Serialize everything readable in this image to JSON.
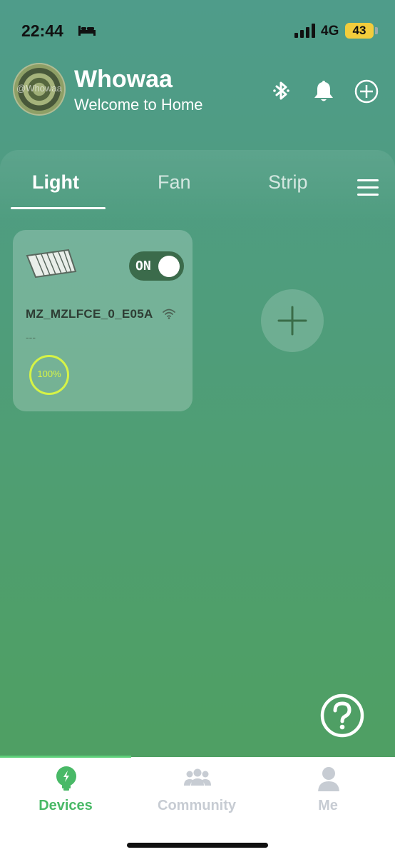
{
  "status_bar": {
    "time": "22:44",
    "network": "4G",
    "battery": "43"
  },
  "header": {
    "avatar_text": "@Whowaa",
    "title": "Whowaa",
    "subtitle": "Welcome to Home"
  },
  "tabs": [
    {
      "label": "Light",
      "active": true
    },
    {
      "label": "Fan",
      "active": false
    },
    {
      "label": "Strip",
      "active": false
    }
  ],
  "device": {
    "name": "MZ_MZLFCE_0_E05A",
    "toggle_label": "ON",
    "toggle_on": true,
    "subtitle": "---",
    "brightness": "100%"
  },
  "bottom_nav": [
    {
      "label": "Devices",
      "icon": "bulb-icon",
      "active": true
    },
    {
      "label": "Community",
      "icon": "people-icon",
      "active": false
    },
    {
      "label": "Me",
      "icon": "person-icon",
      "active": false
    }
  ],
  "colors": {
    "accent_green": "#49b967",
    "ring_yellow": "#d6f346",
    "toggle_bg": "#3b6b4b"
  }
}
